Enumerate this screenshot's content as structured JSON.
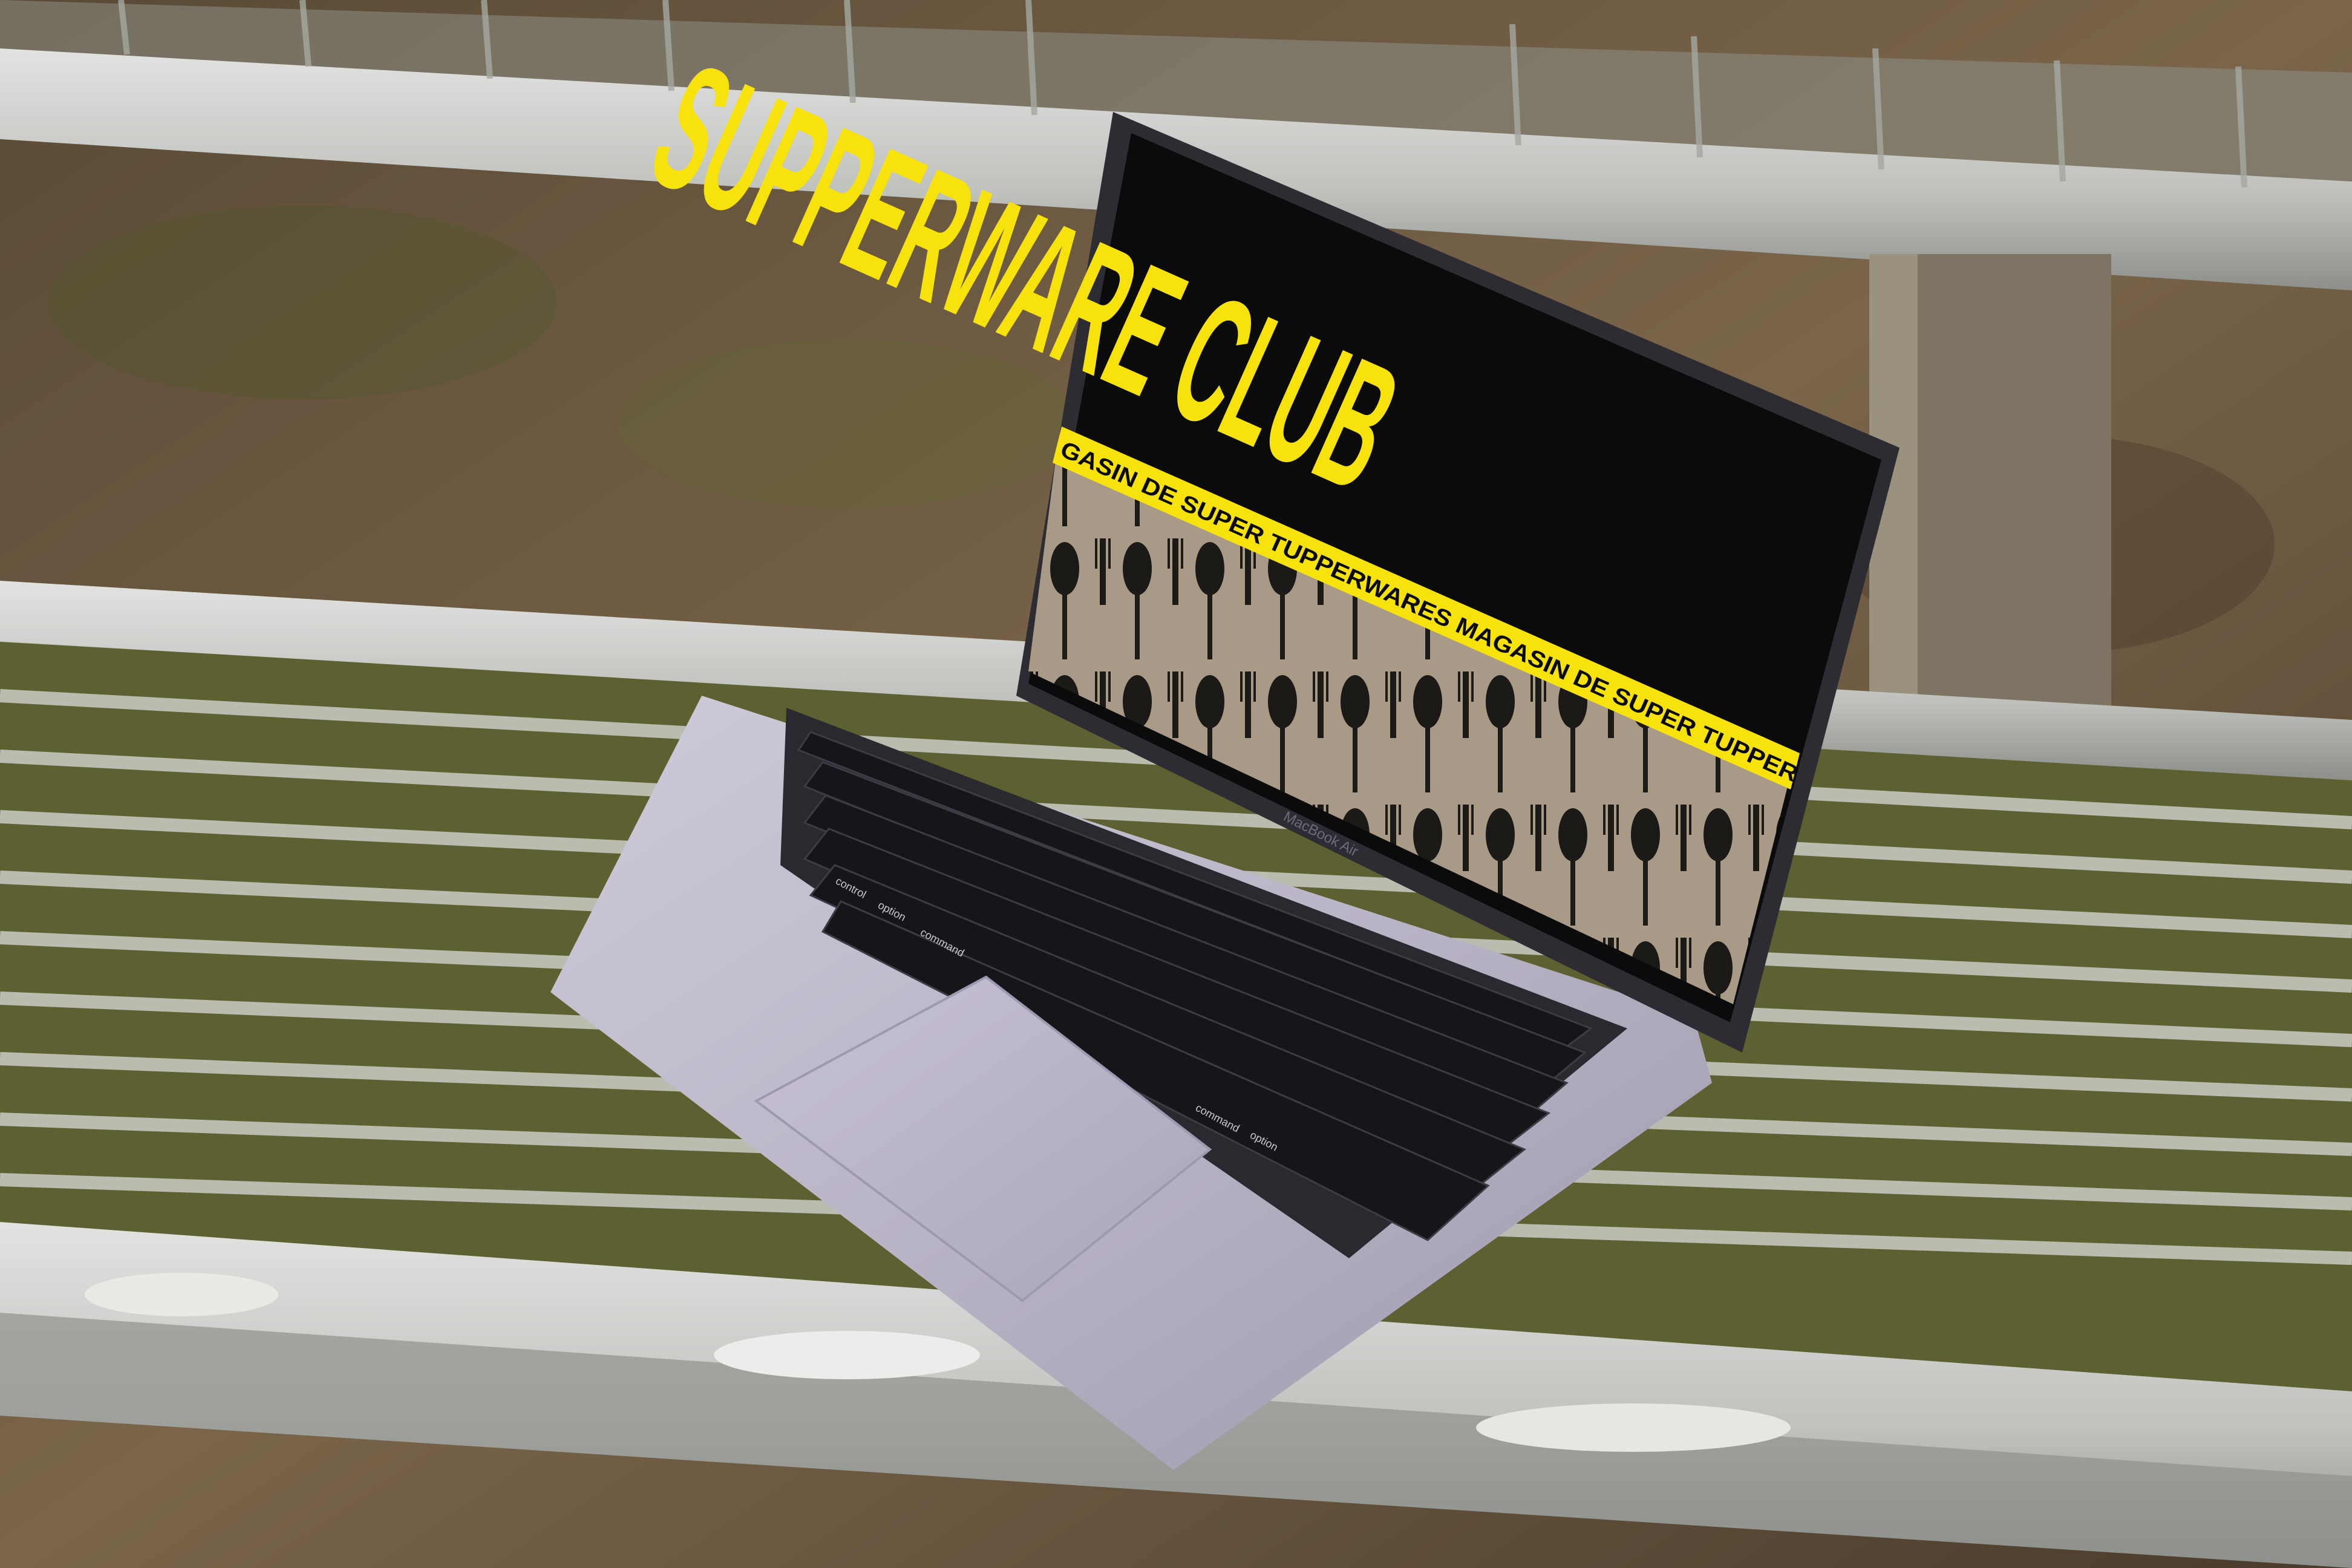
{
  "screen": {
    "title": "SUPPERWARE CLUB",
    "marquee": "GASIN DE SUPER TUPPERWARES MAGASIN DE SUPER TUPPER",
    "colors": {
      "accent": "#f7e20c",
      "background": "#0b0b0b",
      "photo_bg": "#a89a86"
    }
  },
  "laptop": {
    "brand_label": "MacBook Air",
    "key_labels": {
      "control": "control",
      "option": "option",
      "command": "command",
      "command_right": "command",
      "option_right": "option"
    }
  },
  "scene": {
    "description_colors": {
      "ground": "#6b5a44",
      "bench_metal": "#c9c9c7",
      "moss": "#6f7a3a",
      "laptop_body": "#b8b4c4"
    }
  }
}
